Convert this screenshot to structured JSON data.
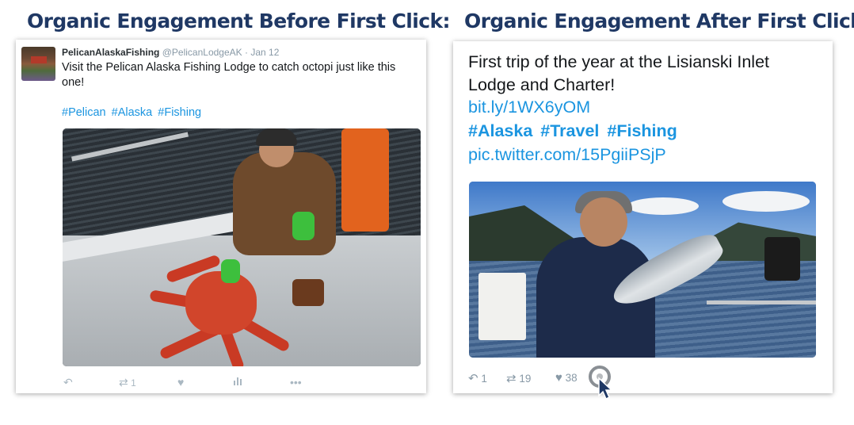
{
  "headings": {
    "before": "Organic Engagement Before First Click:",
    "after": "Organic Engagement After First Click:"
  },
  "tweet_before": {
    "name": "PelicanAlaskaFishing",
    "handle": "@PelicanLodgeAK",
    "separator": "·",
    "date": "Jan 12",
    "text": "Visit the Pelican Alaska Fishing Lodge to catch octopi just like this one!",
    "hashtags": [
      "#Pelican",
      "#Alaska",
      "#Fishing"
    ],
    "actions": {
      "reply_icon": "reply-icon",
      "retweet_icon": "retweet-icon",
      "retweet_count": "1",
      "like_icon": "heart-icon",
      "analytics_icon": "analytics-icon",
      "more_icon": "more-icon"
    }
  },
  "tweet_after": {
    "text": "First trip of the year at the Lisianski Inlet Lodge and Charter!",
    "link": "bit.ly/1WX6yOM",
    "hashtags": [
      "#Alaska",
      "#Travel",
      "#Fishing"
    ],
    "pic_link": "pic.twitter.com/15PgiiPSjP",
    "actions": {
      "reply_count": "1",
      "retweet_count": "19",
      "like_count": "38"
    }
  },
  "colors": {
    "heading": "#1f3864",
    "link": "#1b95e0",
    "action_gray": "#aab8c2"
  }
}
